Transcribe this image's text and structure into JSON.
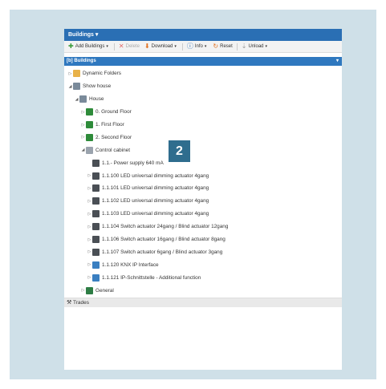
{
  "window": {
    "title": "Buildings ▾"
  },
  "toolbar": {
    "add": "Add Buildings",
    "delete": "Delete",
    "download": "Download",
    "info": "Info",
    "reset": "Reset",
    "unload": "Unload"
  },
  "panel": {
    "title": "Buildings"
  },
  "tree": {
    "dynamic_folders": "Dynamic Folders",
    "show_house": "Show house",
    "house": "House",
    "ground_floor": "0. Ground Floor",
    "first_floor": "1. First Floor",
    "second_floor": "2. Second Floor",
    "control_cabinet": "Control cabinet",
    "devices": [
      "1.1.- Power supply 640 mA",
      "1.1.100 LED universal dimming actuator 4gang",
      "1.1.101 LED universal dimming actuator 4gang",
      "1.1.102 LED universal dimming actuator 4gang",
      "1.1.103 LED universal dimming actuator 4gang",
      "1.1.104 Switch actuator 24gang / Blind actuator 12gang",
      "1.1.106 Switch actuator 16gang / Blind actuator 8gang",
      "1.1.107 Switch actuator 6gang / Blind actuator 3gang",
      "1.1.120 KNX IP Interface",
      "1.1.121 IP-Schnittstelle - Additional function"
    ],
    "general": "General"
  },
  "trades": {
    "label": "Trades"
  },
  "badge": "2"
}
